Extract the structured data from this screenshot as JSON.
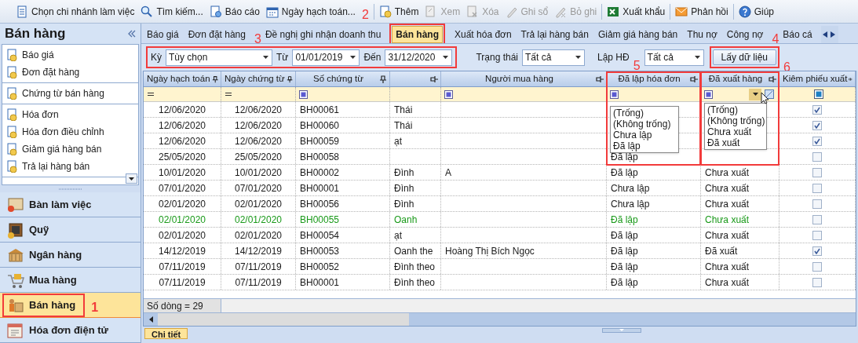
{
  "toolbar": [
    {
      "label": "Chọn chi nhánh làm việc",
      "disabled": false
    },
    {
      "label": "Tìm kiếm...",
      "disabled": false
    },
    {
      "label": "Báo cáo",
      "disabled": false
    },
    {
      "label": "Ngày hạch toán...",
      "disabled": false
    },
    {
      "label": "Thêm",
      "disabled": false
    },
    {
      "label": "Xem",
      "disabled": true
    },
    {
      "label": "Xóa",
      "disabled": true
    },
    {
      "label": "Ghi sổ",
      "disabled": true
    },
    {
      "label": "Bỏ ghi",
      "disabled": true
    },
    {
      "label": "Xuất khẩu",
      "disabled": false
    },
    {
      "label": "Phản hồi",
      "disabled": false
    },
    {
      "label": "Giúp",
      "disabled": false
    }
  ],
  "sidebar": {
    "title": "Bán hàng",
    "groups": [
      {
        "items": [
          "Báo giá",
          "Đơn đặt hàng"
        ]
      },
      {
        "items": [
          "Chứng từ bán hàng"
        ]
      },
      {
        "items": [
          "Hóa đơn",
          "Hóa đơn điều chỉnh",
          "Giảm giá hàng bán",
          "Trả lại hàng bán"
        ]
      }
    ],
    "nav": [
      {
        "label": "Bàn làm việc",
        "selected": false
      },
      {
        "label": "Quỹ",
        "selected": false
      },
      {
        "label": "Ngân hàng",
        "selected": false
      },
      {
        "label": "Mua hàng",
        "selected": false
      },
      {
        "label": "Bán hàng",
        "selected": true
      },
      {
        "label": "Hóa đơn điện tử",
        "selected": false
      }
    ]
  },
  "tabs": [
    {
      "label": "Báo giá",
      "selected": false
    },
    {
      "label": "Đơn đặt hàng",
      "selected": false
    },
    {
      "label": "Đề nghị ghi nhận doanh thu",
      "selected": false
    },
    {
      "label": "Bán hàng",
      "selected": true
    },
    {
      "label": "Xuất hóa đơn",
      "selected": false
    },
    {
      "label": "Trả lại hàng bán",
      "selected": false
    },
    {
      "label": "Giảm giá hàng bán",
      "selected": false
    },
    {
      "label": "Thu nợ",
      "selected": false
    },
    {
      "label": "Công nợ",
      "selected": false
    },
    {
      "label": "Báo cá",
      "selected": false
    }
  ],
  "filters": {
    "period_label": "Kỳ",
    "period": "Tùy chọn",
    "from_label": "Từ",
    "from": "01/01/2019",
    "to_label": "Đến",
    "to": "31/12/2020",
    "status_label": "Trạng thái",
    "status": "Tất cả",
    "invoice_label": "Lập HĐ",
    "invoice": "Tất cả",
    "button": "Lấy dữ liệu"
  },
  "table": {
    "columns": [
      "Ngày hạch toán",
      "Ngày chứng từ",
      "Số chứng từ",
      "Người mua hàng",
      "Đã lập hóa đơn",
      "Đã xuất hàng",
      "Kiêm phiếu xuất"
    ],
    "rows": [
      {
        "posting_date": "12/06/2020",
        "doc_date": "12/06/2020",
        "doc_no": "BH00061",
        "column_4": "Thái",
        "delivery_note": true,
        "highlighted": false
      },
      {
        "posting_date": "12/06/2020",
        "doc_date": "12/06/2020",
        "doc_no": "BH00060",
        "column_4": "Thái",
        "delivery_note": true,
        "highlighted": false
      },
      {
        "posting_date": "12/06/2020",
        "doc_date": "12/06/2020",
        "doc_no": "BH00059",
        "column_4": "ạt",
        "delivery_note": true,
        "highlighted": false
      },
      {
        "posting_date": "25/05/2020",
        "doc_date": "25/05/2020",
        "doc_no": "BH00058",
        "invoiced": "Đã lập",
        "delivery_note": false,
        "highlighted": false
      },
      {
        "posting_date": "10/01/2020",
        "doc_date": "10/01/2020",
        "doc_no": "BH00002",
        "column_4": "Đình",
        "buyer": "A",
        "invoiced": "Đã lập",
        "shipped": "Chưa xuất",
        "delivery_note": false,
        "highlighted": false
      },
      {
        "posting_date": "07/01/2020",
        "doc_date": "07/01/2020",
        "doc_no": "BH00001",
        "column_4": "Đình",
        "invoiced": "Chưa lập",
        "shipped": "Chưa xuất",
        "delivery_note": false,
        "highlighted": false
      },
      {
        "posting_date": "02/01/2020",
        "doc_date": "02/01/2020",
        "doc_no": "BH00056",
        "column_4": "Đình",
        "invoiced": "Chưa lập",
        "shipped": "Chưa xuất",
        "delivery_note": false,
        "highlighted": false
      },
      {
        "posting_date": "02/01/2020",
        "doc_date": "02/01/2020",
        "doc_no": "BH00055",
        "column_4": "Oanh",
        "invoiced": "Đã lập",
        "shipped": "Chưa xuất",
        "delivery_note": false,
        "highlighted": true
      },
      {
        "posting_date": "02/01/2020",
        "doc_date": "02/01/2020",
        "doc_no": "BH00054",
        "column_4": "ạt",
        "invoiced": "Đã lập",
        "shipped": "Chưa xuất",
        "delivery_note": false,
        "highlighted": false
      },
      {
        "posting_date": "14/12/2019",
        "doc_date": "14/12/2019",
        "doc_no": "BH00053",
        "column_4": "Oanh the",
        "buyer": "Hoàng Thị Bích Ngọc",
        "invoiced": "Đã lập",
        "shipped": "Đã xuất",
        "delivery_note": true,
        "highlighted": false
      },
      {
        "posting_date": "07/11/2019",
        "doc_date": "07/11/2019",
        "doc_no": "BH00052",
        "column_4": "Đình theo",
        "invoiced": "Đã lập",
        "shipped": "Chưa xuất",
        "delivery_note": false,
        "highlighted": false
      },
      {
        "posting_date": "07/11/2019",
        "doc_date": "07/11/2019",
        "doc_no": "BH00001",
        "column_4": "Đình theo",
        "invoiced": "Đã lập",
        "shipped": "Chưa xuất",
        "delivery_note": false,
        "highlighted": false
      }
    ],
    "row_count": "Số dòng = 29"
  },
  "filter_popups": [
    {
      "items": [
        "(Trống)",
        "(Không trống)",
        "Chưa lập",
        "Đã lập"
      ]
    },
    {
      "items": [
        "(Trống)",
        "(Không trống)",
        "Chưa xuất",
        "Đã xuất"
      ]
    }
  ],
  "bottom_tab": "Chi tiết",
  "annotations": [
    "1",
    "2",
    "3",
    "4",
    "5",
    "6"
  ]
}
